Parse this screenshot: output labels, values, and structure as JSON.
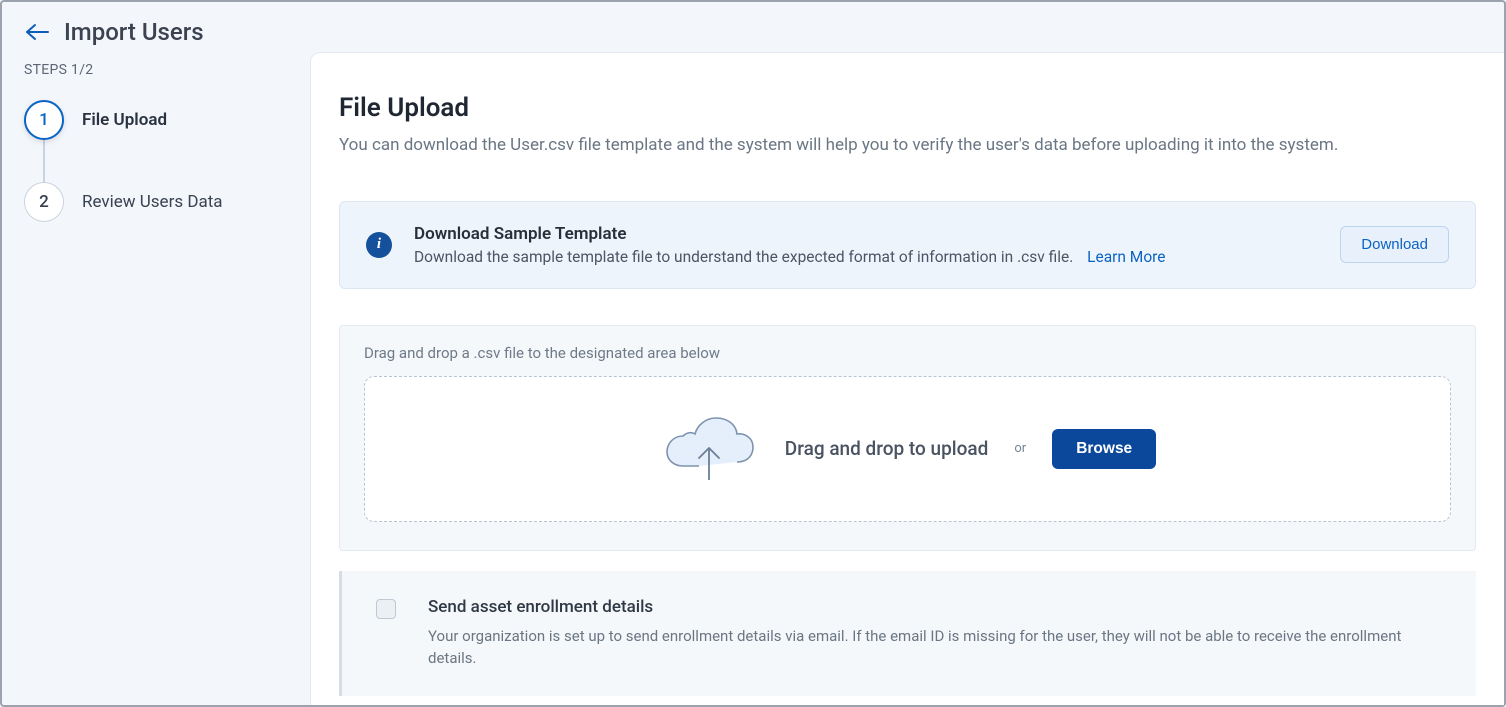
{
  "header": {
    "title": "Import Users"
  },
  "sidebar": {
    "steps_label": "STEPS 1/2",
    "steps": [
      {
        "num": "1",
        "label": "File Upload",
        "active": true
      },
      {
        "num": "2",
        "label": "Review Users Data",
        "active": false
      }
    ]
  },
  "main": {
    "title": "File Upload",
    "description": "You can download the User.csv file template and the system will help you to verify the user's data before uploading it into the system.",
    "info_card": {
      "title": "Download Sample Template",
      "description": "Download the sample template file to understand the expected format of information in .csv file.",
      "learn_more": "Learn More",
      "download_button": "Download"
    },
    "upload": {
      "hint": "Drag and drop a .csv file to the designated area below",
      "drop_text": "Drag and drop to upload",
      "or_text": "or",
      "browse_button": "Browse"
    },
    "enrollment": {
      "checkbox_checked": false,
      "title": "Send asset enrollment details",
      "description": "Your organization is set up to send enrollment details via email. If the email ID is missing for the user, they will not be able to receive the enrollment details."
    }
  }
}
